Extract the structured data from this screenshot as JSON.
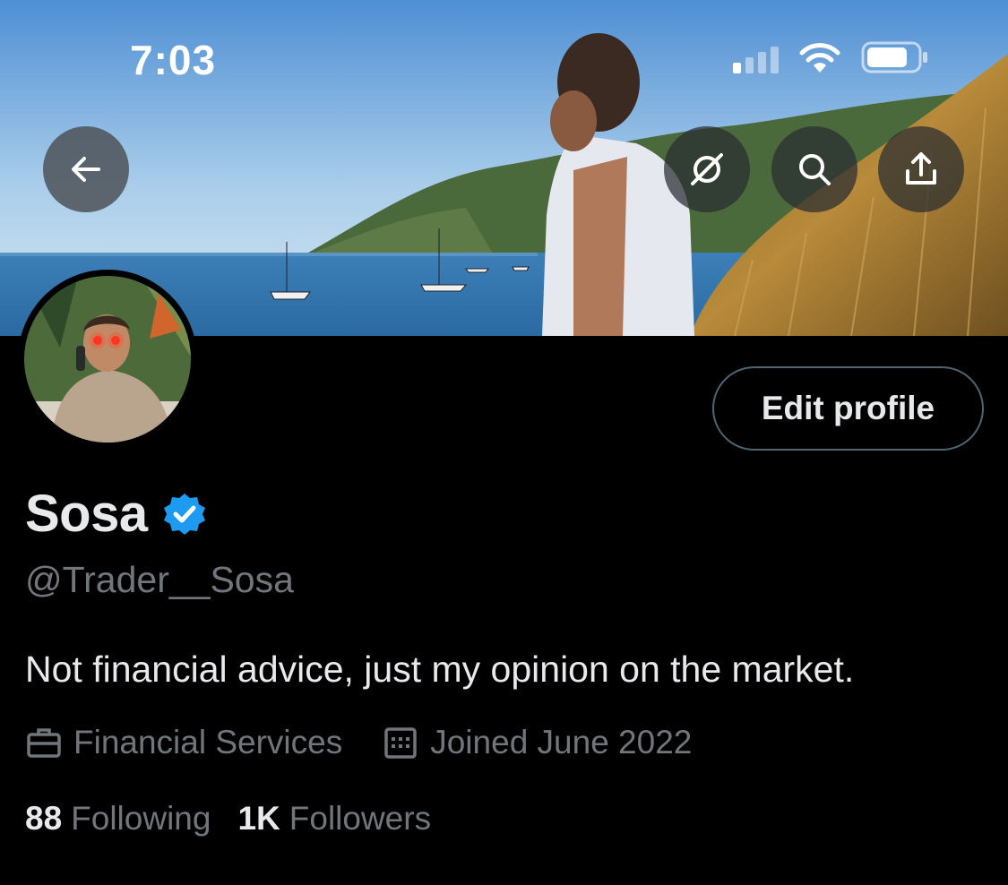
{
  "status_bar": {
    "time": "7:03",
    "signal_bars_active": 1,
    "signal_bars_total": 4,
    "wifi_icon": "wifi-icon",
    "battery_icon": "battery-icon"
  },
  "nav": {
    "back_icon": "arrow-left-icon",
    "grok_icon": "grok-icon",
    "search_icon": "search-icon",
    "share_icon": "share-icon"
  },
  "profile": {
    "display_name": "Sosa",
    "verified_icon": "verified-badge-icon",
    "handle": "@Trader__Sosa",
    "edit_label": "Edit profile",
    "bio": "Not financial advice, just my opinion on the market.",
    "category": "Financial Services",
    "category_icon": "briefcase-icon",
    "joined": "Joined June 2022",
    "joined_icon": "calendar-icon",
    "following_count": "88",
    "following_label": "Following",
    "followers_count": "1K",
    "followers_label": "Followers"
  },
  "colors": {
    "background": "#000000",
    "primary_text": "#e7e9ea",
    "secondary_text": "#71767b",
    "verified_blue": "#1d9bf0",
    "button_border": "#536471"
  }
}
